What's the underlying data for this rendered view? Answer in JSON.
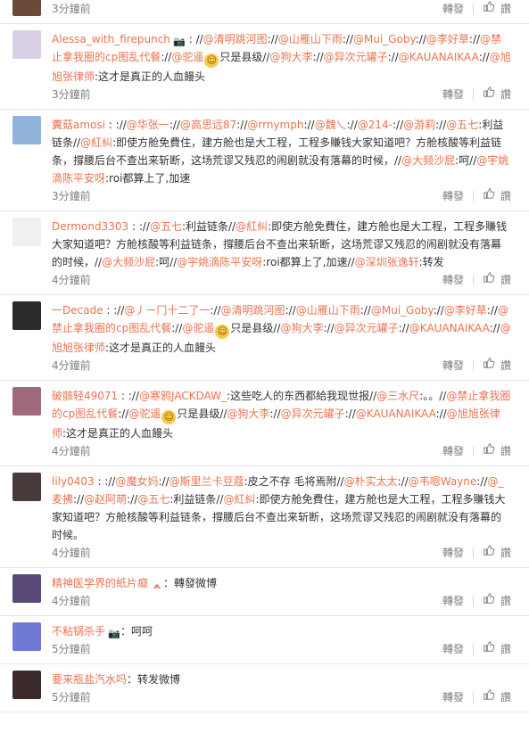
{
  "actions": {
    "repost": "轉發",
    "like": "讚"
  },
  "comments": [
    {
      "avatar_color": "#6b4a3a",
      "avatar_icon": "user-photo-icon",
      "username": "",
      "segments": [],
      "time": "3分鐘前"
    },
    {
      "avatar_color": "#d9d0e6",
      "avatar_icon": "user-photo-icon",
      "username": "Alessa_with_firepunch",
      "badge": "📷",
      "segments": [
        {
          "t": "plain",
          "v": "//"
        },
        {
          "t": "mention",
          "v": "@清明跳河图"
        },
        {
          "t": "plain",
          "v": "://"
        },
        {
          "t": "mention",
          "v": "@山雁山下雨"
        },
        {
          "t": "plain",
          "v": "://"
        },
        {
          "t": "mention",
          "v": "@Mui_Goby"
        },
        {
          "t": "plain",
          "v": "://"
        },
        {
          "t": "mention",
          "v": "@李好草"
        },
        {
          "t": "plain",
          "v": "://"
        },
        {
          "t": "mention",
          "v": "@禁止拿我圈的cp图乱代餐"
        },
        {
          "t": "plain",
          "v": "://"
        },
        {
          "t": "mention",
          "v": "@驼遥"
        },
        {
          "t": "emoji",
          "v": "☺"
        },
        {
          "t": "plain",
          "v": "只是县级//"
        },
        {
          "t": "mention",
          "v": "@狗大李"
        },
        {
          "t": "plain",
          "v": "://"
        },
        {
          "t": "mention",
          "v": "@异次元罐子"
        },
        {
          "t": "plain",
          "v": "://"
        },
        {
          "t": "mention",
          "v": "@KAUANAIKAA"
        },
        {
          "t": "plain",
          "v": "://"
        },
        {
          "t": "mention",
          "v": "@旭旭张律师"
        },
        {
          "t": "plain",
          "v": ":这才是真正的人血饅头"
        }
      ],
      "time": "3分鐘前"
    },
    {
      "avatar_color": "#8fb3d9",
      "avatar_icon": "user-photo-icon",
      "username": "糞菇amosi",
      "segments": [
        {
          "t": "plain",
          "v": "://"
        },
        {
          "t": "mention",
          "v": "@华张一"
        },
        {
          "t": "plain",
          "v": "://"
        },
        {
          "t": "mention",
          "v": "@高思远87"
        },
        {
          "t": "plain",
          "v": "://"
        },
        {
          "t": "mention",
          "v": "@rrnymph"
        },
        {
          "t": "plain",
          "v": "://"
        },
        {
          "t": "mention",
          "v": "@魏乀"
        },
        {
          "t": "plain",
          "v": "://"
        },
        {
          "t": "mention",
          "v": "@214-"
        },
        {
          "t": "plain",
          "v": "://"
        },
        {
          "t": "mention",
          "v": "@游莉"
        },
        {
          "t": "plain",
          "v": "://"
        },
        {
          "t": "mention",
          "v": "@五七"
        },
        {
          "t": "plain",
          "v": ":利益链条//"
        },
        {
          "t": "mention",
          "v": "@紅糾"
        },
        {
          "t": "plain",
          "v": ":即使方舱免費住，建方舱也是大工程，工程多賺钱大家知道吧？方舱核酸等利益链条，撐腰后台不查出来斩断，这场荒谬又残忍的闹剧就没有落幕的时候，//"
        },
        {
          "t": "mention",
          "v": "@大频沙屁"
        },
        {
          "t": "plain",
          "v": ":呵//"
        },
        {
          "t": "mention",
          "v": "@宇姚滴陈平安呀"
        },
        {
          "t": "plain",
          "v": ":roi都算上了,加速"
        }
      ],
      "time": "3分鐘前"
    },
    {
      "avatar_color": "#f0f0f0",
      "avatar_icon": "user-photo-icon",
      "username": "Dermond3303",
      "segments": [
        {
          "t": "plain",
          "v": "://"
        },
        {
          "t": "mention",
          "v": "@五七"
        },
        {
          "t": "plain",
          "v": ":利益链条//"
        },
        {
          "t": "mention",
          "v": "@紅糾"
        },
        {
          "t": "plain",
          "v": ":即使方舱免費住，建方舱也是大工程，工程多賺钱大家知道吧？方舱核酸等利益链条，撐腰后台不查出来斩断，这场荒谬又残忍的闹剧就没有落幕的时候，//"
        },
        {
          "t": "mention",
          "v": "@大频沙屁"
        },
        {
          "t": "plain",
          "v": ":呵//"
        },
        {
          "t": "mention",
          "v": "@宇姚滴陈平安呀"
        },
        {
          "t": "plain",
          "v": ":roi都算上了,加速//"
        },
        {
          "t": "mention",
          "v": "@深圳张逸轩"
        },
        {
          "t": "plain",
          "v": ":转发"
        }
      ],
      "time": "4分鐘前"
    },
    {
      "avatar_color": "#2b2b2b",
      "avatar_icon": "user-photo-icon",
      "username": "一Decade",
      "segments": [
        {
          "t": "plain",
          "v": "://"
        },
        {
          "t": "mention",
          "v": "@丿ㄧ冂十二了一"
        },
        {
          "t": "plain",
          "v": "://"
        },
        {
          "t": "mention",
          "v": "@清明跳河图"
        },
        {
          "t": "plain",
          "v": "://"
        },
        {
          "t": "mention",
          "v": "@山雁山下雨"
        },
        {
          "t": "plain",
          "v": "://"
        },
        {
          "t": "mention",
          "v": "@Mui_Goby"
        },
        {
          "t": "plain",
          "v": "://"
        },
        {
          "t": "mention",
          "v": "@李好草"
        },
        {
          "t": "plain",
          "v": "://"
        },
        {
          "t": "mention",
          "v": "@禁止拿我圈的cp图乱代餐"
        },
        {
          "t": "plain",
          "v": "://"
        },
        {
          "t": "mention",
          "v": "@驼遥"
        },
        {
          "t": "emoji",
          "v": "☺"
        },
        {
          "t": "plain",
          "v": "只是县级//"
        },
        {
          "t": "mention",
          "v": "@狗大李"
        },
        {
          "t": "plain",
          "v": "://"
        },
        {
          "t": "mention",
          "v": "@异次元罐子"
        },
        {
          "t": "plain",
          "v": "://"
        },
        {
          "t": "mention",
          "v": "@KAUANAIKAA"
        },
        {
          "t": "plain",
          "v": "://"
        },
        {
          "t": "mention",
          "v": "@旭旭张律师"
        },
        {
          "t": "plain",
          "v": ":这才是真正的人血饅头"
        }
      ],
      "time": "4分鐘前"
    },
    {
      "avatar_color": "#a06a7a",
      "avatar_icon": "user-photo-icon",
      "username": "破骸轻49071",
      "segments": [
        {
          "t": "plain",
          "v": "://"
        },
        {
          "t": "mention",
          "v": "@寒鸦JACKDAW_"
        },
        {
          "t": "plain",
          "v": ":这些吃人的东西都給我现世报//"
        },
        {
          "t": "mention",
          "v": "@三水尺"
        },
        {
          "t": "plain",
          "v": ":。。//"
        },
        {
          "t": "mention",
          "v": "@禁止拿我圈的cp图乱代餐"
        },
        {
          "t": "plain",
          "v": "://"
        },
        {
          "t": "mention",
          "v": "@驼遥"
        },
        {
          "t": "emoji",
          "v": "☺"
        },
        {
          "t": "plain",
          "v": "只是县级//"
        },
        {
          "t": "mention",
          "v": "@狗大李"
        },
        {
          "t": "plain",
          "v": "://"
        },
        {
          "t": "mention",
          "v": "@异次元罐子"
        },
        {
          "t": "plain",
          "v": "://"
        },
        {
          "t": "mention",
          "v": "@KAUANAIKAA"
        },
        {
          "t": "plain",
          "v": "://"
        },
        {
          "t": "mention",
          "v": "@旭旭张律师"
        },
        {
          "t": "plain",
          "v": ":这才是真正的人血饅头"
        }
      ],
      "time": "4分鐘前"
    },
    {
      "avatar_color": "#4a3b3b",
      "avatar_icon": "user-photo-icon",
      "username": "lily0403",
      "segments": [
        {
          "t": "plain",
          "v": "://"
        },
        {
          "t": "mention",
          "v": "@魔女妈"
        },
        {
          "t": "plain",
          "v": "://"
        },
        {
          "t": "mention",
          "v": "@斯里兰卡豆蔻"
        },
        {
          "t": "plain",
          "v": ":皮之不存 毛将焉附//"
        },
        {
          "t": "mention",
          "v": "@朴实太太"
        },
        {
          "t": "plain",
          "v": "://"
        },
        {
          "t": "mention",
          "v": "@韦嗯Wayne"
        },
        {
          "t": "plain",
          "v": "://"
        },
        {
          "t": "mention",
          "v": "@_麦拂"
        },
        {
          "t": "plain",
          "v": "://"
        },
        {
          "t": "mention",
          "v": "@赵阿萌"
        },
        {
          "t": "plain",
          "v": "://"
        },
        {
          "t": "mention",
          "v": "@五七"
        },
        {
          "t": "plain",
          "v": ":利益链条//"
        },
        {
          "t": "mention",
          "v": "@紅糾"
        },
        {
          "t": "plain",
          "v": ":即使方舱免費住，建方舱也是大工程，工程多賺钱大家知道吧？方舱核酸等利益链条，撐腰后台不查出来斩断，这场荒谬又残忍的闹剧就没有落幕的时候。"
        }
      ],
      "time": "4分鐘前"
    },
    {
      "avatar_color": "#5a4a7a",
      "avatar_icon": "user-photo-icon",
      "username": "精神医学界的紙片癡",
      "badge": "⩕",
      "segments": [
        {
          "t": "plain",
          "v": "：轉發微博"
        }
      ],
      "time": "4分鐘前"
    },
    {
      "avatar_color": "#6f7ad6",
      "avatar_icon": "user-photo-icon",
      "username": "不粘锅杀手",
      "badge": "📷",
      "segments": [
        {
          "t": "plain",
          "v": "：呵呵"
        }
      ],
      "time": "5分鐘前"
    },
    {
      "avatar_color": "#3a2a2a",
      "avatar_icon": "user-photo-icon",
      "username": "要来瓶盐汽水吗",
      "segments": [
        {
          "t": "plain",
          "v": "：转发微博"
        }
      ],
      "time": "5分鐘前"
    }
  ]
}
